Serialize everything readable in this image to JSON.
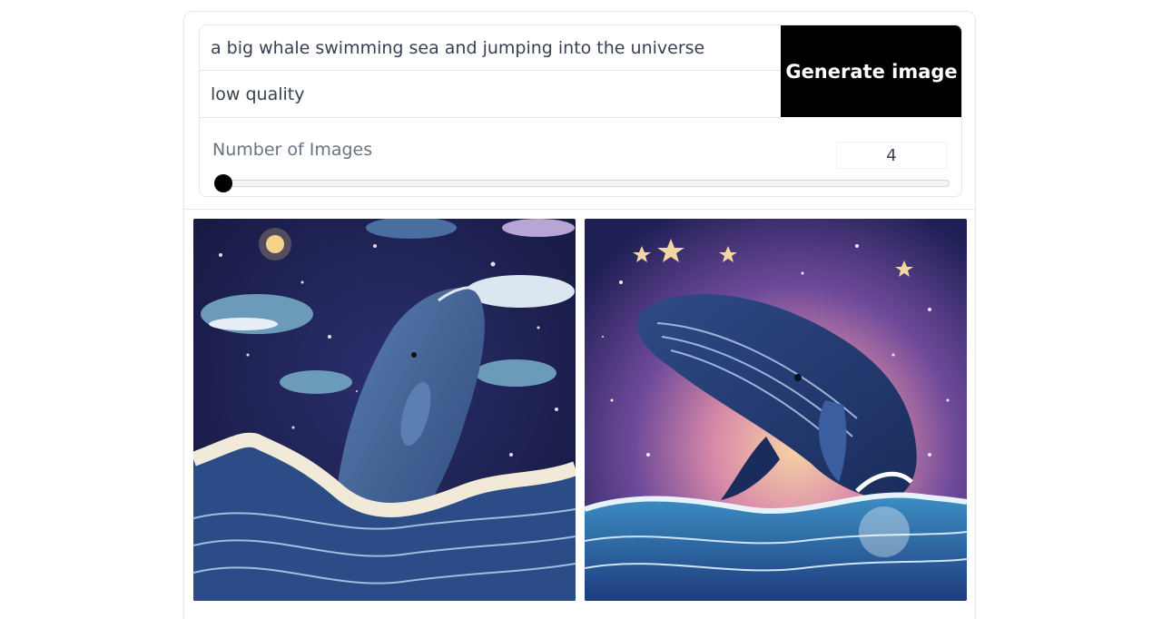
{
  "form": {
    "prompt_value": "a big whale swimming sea and jumping into the universe",
    "negative_prompt_value": "low quality",
    "generate_label": "Generate image"
  },
  "settings": {
    "num_images_label": "Number of Images",
    "num_images_value": "4",
    "slider_level": 0.0
  },
  "gallery": {
    "images": [
      {
        "subject": "whale-illustration-1"
      },
      {
        "subject": "whale-illustration-2"
      }
    ]
  },
  "colors": {
    "button_bg": "#000000",
    "button_text": "#ffffff",
    "border": "#e5e7eb",
    "slider_thumb": "#000000"
  }
}
